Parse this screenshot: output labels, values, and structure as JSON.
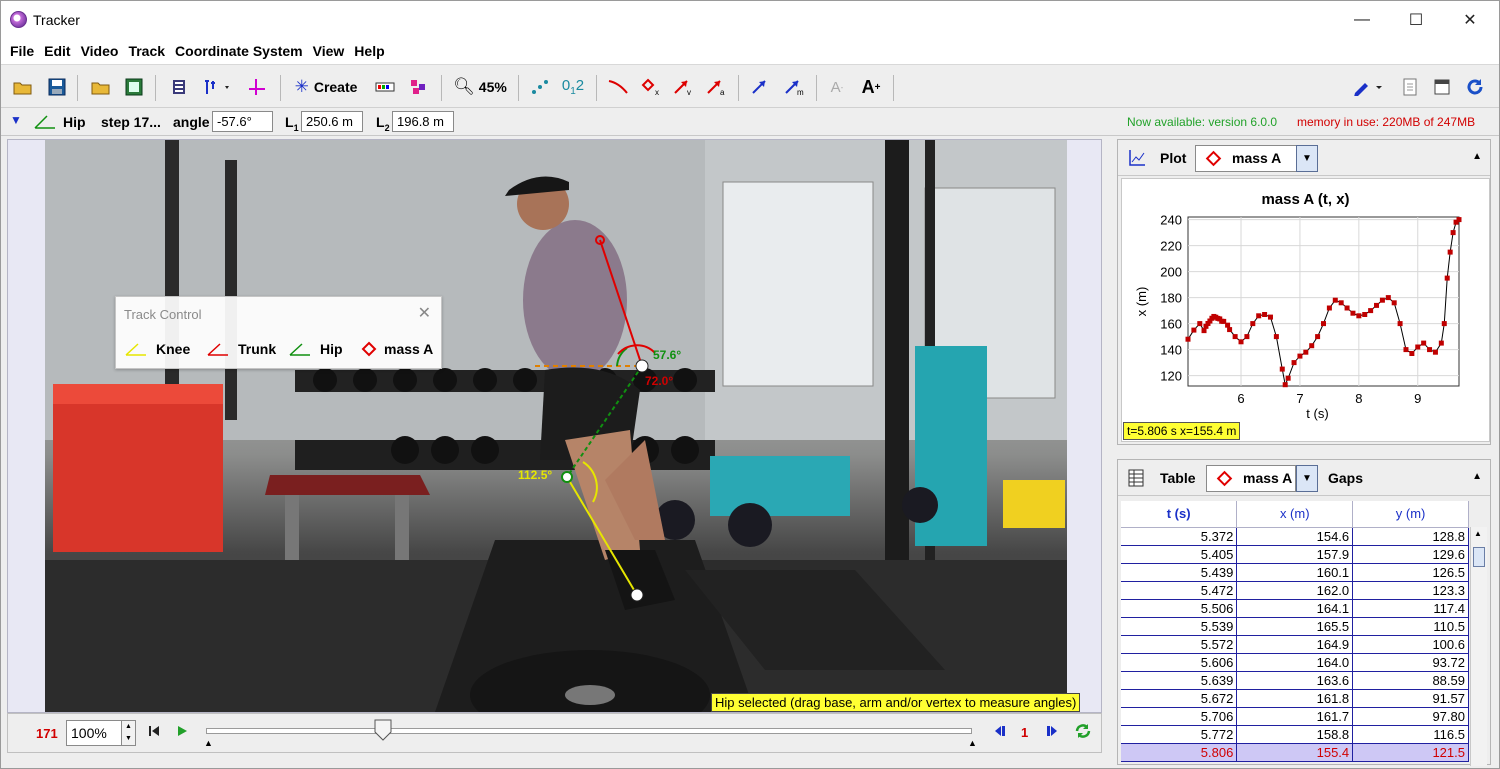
{
  "window": {
    "title": "Tracker",
    "min_glyph": "—",
    "max_glyph": "☐",
    "close_glyph": "✕"
  },
  "menu": [
    "File",
    "Edit",
    "Video",
    "Track",
    "Coordinate System",
    "View",
    "Help"
  ],
  "toolbar": {
    "create_label": "Create",
    "zoom_label": "45%"
  },
  "infobar": {
    "track_name": "Hip",
    "step_label": "step 17...",
    "angle_label": "angle",
    "angle_value": "-57.6°",
    "l1_label": "L",
    "l1_sub": "1",
    "l1_value": "250.6 m",
    "l2_label": "L",
    "l2_sub": "2",
    "l2_value": "196.8 m",
    "version_notice": "Now available: version 6.0.0",
    "memory_notice": "memory in use: 220MB of 247MB"
  },
  "video": {
    "angle_hip_small": "57.6°",
    "angle_hip_large": "72.0°",
    "angle_knee": "112.5°",
    "hint": "Hip selected (drag base, arm and/or vertex to measure angles)"
  },
  "track_control": {
    "title": "Track Control",
    "close_glyph": "✕",
    "items": [
      {
        "label": "Knee",
        "color": "#e6e600"
      },
      {
        "label": "Trunk",
        "color": "#e00000"
      },
      {
        "label": "Hip",
        "color": "#109010"
      },
      {
        "label": "mass A",
        "color": "#e00000"
      }
    ]
  },
  "player": {
    "frame": "171",
    "zoom": "100%",
    "step_value": "1"
  },
  "plot_panel": {
    "title": "Plot",
    "track": "mass A",
    "readout": "t=5.806 s  x=155.4 m"
  },
  "chart_data": {
    "type": "scatter",
    "title": "mass A (t, x)",
    "xlabel": "t (s)",
    "ylabel": "x (m)",
    "xlim": [
      5.1,
      9.7
    ],
    "ylim": [
      112,
      242
    ],
    "xticks": [
      6,
      7,
      8,
      9
    ],
    "yticks": [
      120,
      140,
      160,
      180,
      200,
      220,
      240
    ],
    "grid": true,
    "series": [
      {
        "color": "#c00000",
        "x": [
          5.1,
          5.2,
          5.3,
          5.372,
          5.405,
          5.439,
          5.472,
          5.506,
          5.539,
          5.572,
          5.606,
          5.639,
          5.672,
          5.706,
          5.772,
          5.806,
          5.9,
          6.0,
          6.1,
          6.2,
          6.3,
          6.4,
          6.5,
          6.6,
          6.7,
          6.75,
          6.8,
          6.9,
          7.0,
          7.1,
          7.2,
          7.3,
          7.4,
          7.5,
          7.6,
          7.7,
          7.8,
          7.9,
          8.0,
          8.1,
          8.2,
          8.3,
          8.4,
          8.5,
          8.6,
          8.7,
          8.8,
          8.9,
          9.0,
          9.1,
          9.2,
          9.3,
          9.4,
          9.45,
          9.5,
          9.55,
          9.6,
          9.65,
          9.7
        ],
        "y": [
          148,
          155,
          160,
          154.6,
          157.9,
          160.1,
          162.0,
          164.1,
          165.5,
          164.9,
          164.0,
          163.6,
          161.8,
          161.7,
          158.8,
          155.4,
          150,
          146,
          150,
          160,
          166,
          167,
          165,
          150,
          125,
          113,
          118,
          130,
          135,
          138,
          143,
          150,
          160,
          172,
          178,
          176,
          172,
          168,
          166,
          167,
          170,
          174,
          178,
          180,
          176,
          160,
          140,
          137,
          142,
          145,
          140,
          138,
          145,
          160,
          195,
          215,
          230,
          238,
          240
        ]
      }
    ]
  },
  "table_panel": {
    "title": "Table",
    "track": "mass A",
    "gaps_label": "Gaps",
    "columns": [
      "t (s)",
      "x (m)",
      "y (m)"
    ],
    "rows": [
      [
        "5.372",
        "154.6",
        "128.8"
      ],
      [
        "5.405",
        "157.9",
        "129.6"
      ],
      [
        "5.439",
        "160.1",
        "126.5"
      ],
      [
        "5.472",
        "162.0",
        "123.3"
      ],
      [
        "5.506",
        "164.1",
        "117.4"
      ],
      [
        "5.539",
        "165.5",
        "110.5"
      ],
      [
        "5.572",
        "164.9",
        "100.6"
      ],
      [
        "5.606",
        "164.0",
        "93.72"
      ],
      [
        "5.639",
        "163.6",
        "88.59"
      ],
      [
        "5.672",
        "161.8",
        "91.57"
      ],
      [
        "5.706",
        "161.7",
        "97.80"
      ],
      [
        "5.772",
        "158.8",
        "116.5"
      ],
      [
        "5.806",
        "155.4",
        "121.5"
      ]
    ]
  },
  "colors": {
    "knee": "#e6e600",
    "trunk": "#e00000",
    "hip": "#109010",
    "massA": "#e00000",
    "accent": "#1a30c8"
  }
}
